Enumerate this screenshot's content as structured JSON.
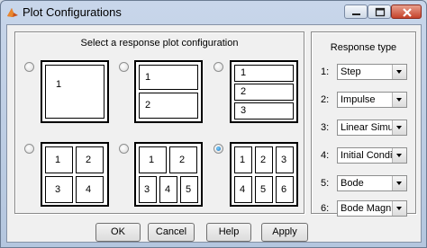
{
  "window": {
    "title": "Plot Configurations"
  },
  "left_panel": {
    "title": "Select a response plot configuration",
    "configs": [
      {
        "selected": false,
        "cells": [
          "1"
        ]
      },
      {
        "selected": false,
        "cells": [
          "1",
          "2"
        ]
      },
      {
        "selected": false,
        "cells": [
          "1",
          "2",
          "3"
        ]
      },
      {
        "selected": false,
        "cells": [
          "1",
          "2",
          "3",
          "4"
        ]
      },
      {
        "selected": false,
        "cells": [
          "1",
          "2",
          "3",
          "4",
          "5"
        ]
      },
      {
        "selected": true,
        "cells": [
          "1",
          "2",
          "3",
          "4",
          "5",
          "6"
        ]
      }
    ]
  },
  "right_panel": {
    "title": "Response type",
    "items": [
      {
        "num": "1:",
        "value": "Step"
      },
      {
        "num": "2:",
        "value": "Impulse"
      },
      {
        "num": "3:",
        "value": "Linear Simul..."
      },
      {
        "num": "4:",
        "value": "Initial Condition"
      },
      {
        "num": "5:",
        "value": "Bode"
      },
      {
        "num": "6:",
        "value": "Bode Magnit..."
      }
    ]
  },
  "buttons": {
    "ok": "OK",
    "cancel": "Cancel",
    "help": "Help",
    "apply": "Apply"
  }
}
